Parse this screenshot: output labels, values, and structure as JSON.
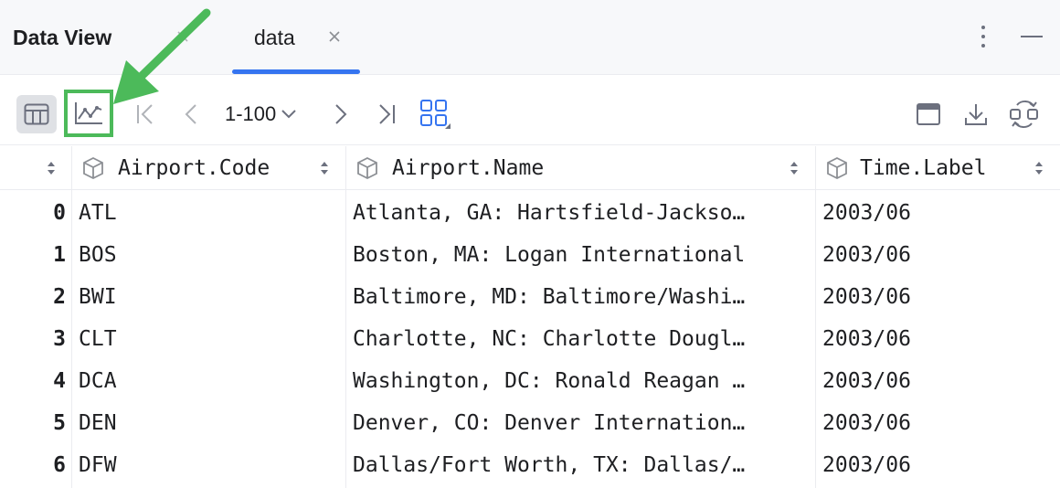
{
  "tabs": [
    {
      "label": "Data View",
      "active": false
    },
    {
      "label": "data",
      "active": true
    }
  ],
  "toolbar": {
    "page_range": "1-100",
    "icons": [
      "table-view-icon",
      "chart-view-icon",
      "first-page-icon",
      "prev-page-icon",
      "chevron-down-icon",
      "next-page-icon",
      "last-page-icon",
      "layout-icon",
      "window-icon",
      "download-icon",
      "refresh-icon"
    ]
  },
  "table": {
    "columns": [
      "Airport.Code",
      "Airport.Name",
      "Time.Label"
    ],
    "rows": [
      {
        "index": "0",
        "code": "ATL",
        "name": "Atlanta, GA: Hartsfield-Jackso…",
        "time": "2003/06"
      },
      {
        "index": "1",
        "code": "BOS",
        "name": "Boston, MA: Logan International",
        "time": "2003/06"
      },
      {
        "index": "2",
        "code": "BWI",
        "name": "Baltimore, MD: Baltimore/Washi…",
        "time": "2003/06"
      },
      {
        "index": "3",
        "code": "CLT",
        "name": "Charlotte, NC: Charlotte Dougl…",
        "time": "2003/06"
      },
      {
        "index": "4",
        "code": "DCA",
        "name": "Washington, DC: Ronald Reagan …",
        "time": "2003/06"
      },
      {
        "index": "5",
        "code": "DEN",
        "name": "Denver, CO: Denver Internation…",
        "time": "2003/06"
      },
      {
        "index": "6",
        "code": "DFW",
        "name": "Dallas/Fort Worth, TX: Dallas/…",
        "time": "2003/06"
      }
    ]
  },
  "colors": {
    "accent": "#3574f0",
    "highlight": "#4cba5a",
    "selected_bg": "#dfe1e5"
  }
}
